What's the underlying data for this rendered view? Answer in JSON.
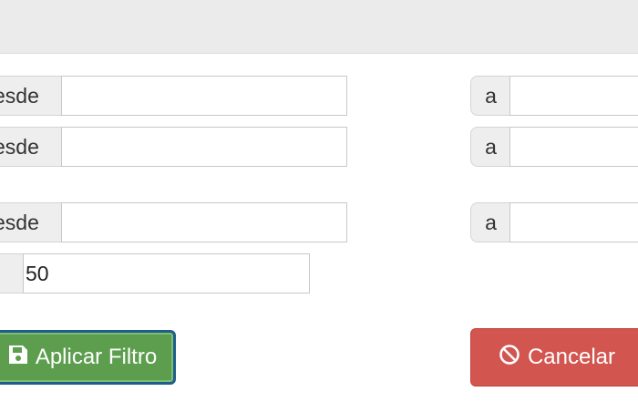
{
  "filter_form": {
    "rows": [
      {
        "from_label": "esde",
        "from_value": "",
        "to_label": "a",
        "to_value": ""
      },
      {
        "from_label": "esde",
        "from_value": "",
        "to_label": "a",
        "to_value": ""
      },
      {
        "from_label": "esde",
        "from_value": "",
        "to_label": "a",
        "to_value": ""
      }
    ],
    "limit_value": "50"
  },
  "actions": {
    "apply_label": "Aplicar Filtro",
    "apply_icon": "save-icon",
    "cancel_label": "Cancelar",
    "cancel_icon": "ban-icon"
  },
  "colors": {
    "apply_bg": "#5c9e4e",
    "apply_border": "#1f5e8c",
    "cancel_bg": "#d2554f"
  }
}
